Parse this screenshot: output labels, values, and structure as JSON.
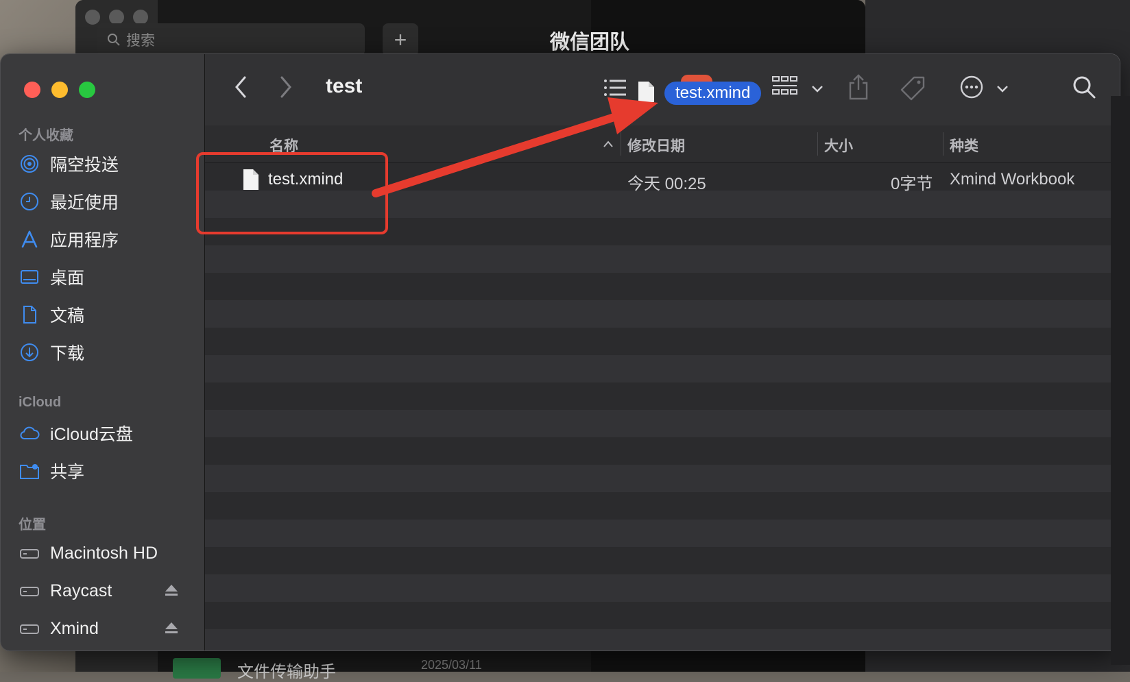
{
  "background": {
    "wechat": {
      "search_placeholder": "搜索",
      "add_label": "+",
      "chat_title": "微信团队",
      "bottom_chat_name": "文件传输助手",
      "bottom_chat_date": "2025/03/11"
    }
  },
  "finder": {
    "title": "test",
    "sidebar": {
      "favorites_header": "个人收藏",
      "favorites": [
        {
          "label": "隔空投送",
          "icon": "airdrop-icon"
        },
        {
          "label": "最近使用",
          "icon": "clock-icon"
        },
        {
          "label": "应用程序",
          "icon": "applications-icon"
        },
        {
          "label": "桌面",
          "icon": "desktop-icon"
        },
        {
          "label": "文稿",
          "icon": "document-icon"
        },
        {
          "label": "下载",
          "icon": "download-icon"
        }
      ],
      "icloud_header": "iCloud",
      "icloud": [
        {
          "label": "iCloud云盘",
          "icon": "cloud-icon"
        },
        {
          "label": "共享",
          "icon": "shared-folder-icon"
        }
      ],
      "locations_header": "位置",
      "locations": [
        {
          "label": "Macintosh HD",
          "icon": "drive-icon"
        },
        {
          "label": "Raycast",
          "icon": "drive-icon"
        },
        {
          "label": "Xmind",
          "icon": "drive-icon"
        }
      ]
    },
    "drag_badge": "test.xmind",
    "columns": {
      "name": "名称",
      "date": "修改日期",
      "size": "大小",
      "kind": "种类"
    },
    "files": [
      {
        "name": "test.xmind",
        "date": "今天 00:25",
        "size": "0字节",
        "kind": "Xmind Workbook"
      }
    ]
  },
  "colors": {
    "accent": "#2a62d8",
    "annotation": "#e63b2e"
  }
}
